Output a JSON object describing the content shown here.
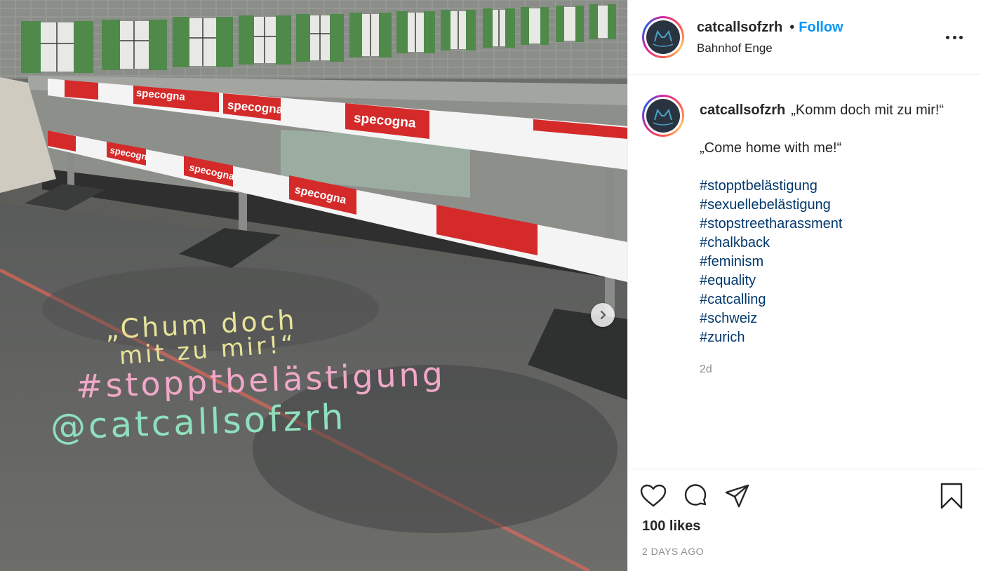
{
  "photo": {
    "brand_text": "specogna",
    "chalk_lines": [
      "„Chum doch",
      "mit zu mir!“",
      "#stopptbelästigung",
      "@catcallsofzrh"
    ]
  },
  "header": {
    "username": "catcallsofzrh",
    "separator": "•",
    "follow_label": "Follow",
    "location": "Bahnhof Enge"
  },
  "caption": {
    "username": "catcallsofzrh",
    "line_1": "„Komm doch mit zu mir!“",
    "line_2": "„Come home with me!“",
    "hashtags": [
      "#stopptbelästigung",
      "#sexuellebelästigung",
      "#stopstreetharassment",
      "#chalkback",
      "#feminism",
      "#equality",
      "#catcalling",
      "#schweiz",
      "#zurich"
    ],
    "time_ago": "2d"
  },
  "footer": {
    "likes": "100 likes",
    "date": "2 DAYS AGO"
  },
  "colors": {
    "follow": "#0095f6",
    "hashtag": "#00376b",
    "muted": "#8e8e8e",
    "barrier_red": "#d42a2a"
  },
  "icons": {
    "like": "heart-icon",
    "comment": "comment-icon",
    "share": "paper-plane-icon",
    "save": "bookmark-icon",
    "more": "more-options-icon",
    "next": "chevron-right-icon"
  }
}
